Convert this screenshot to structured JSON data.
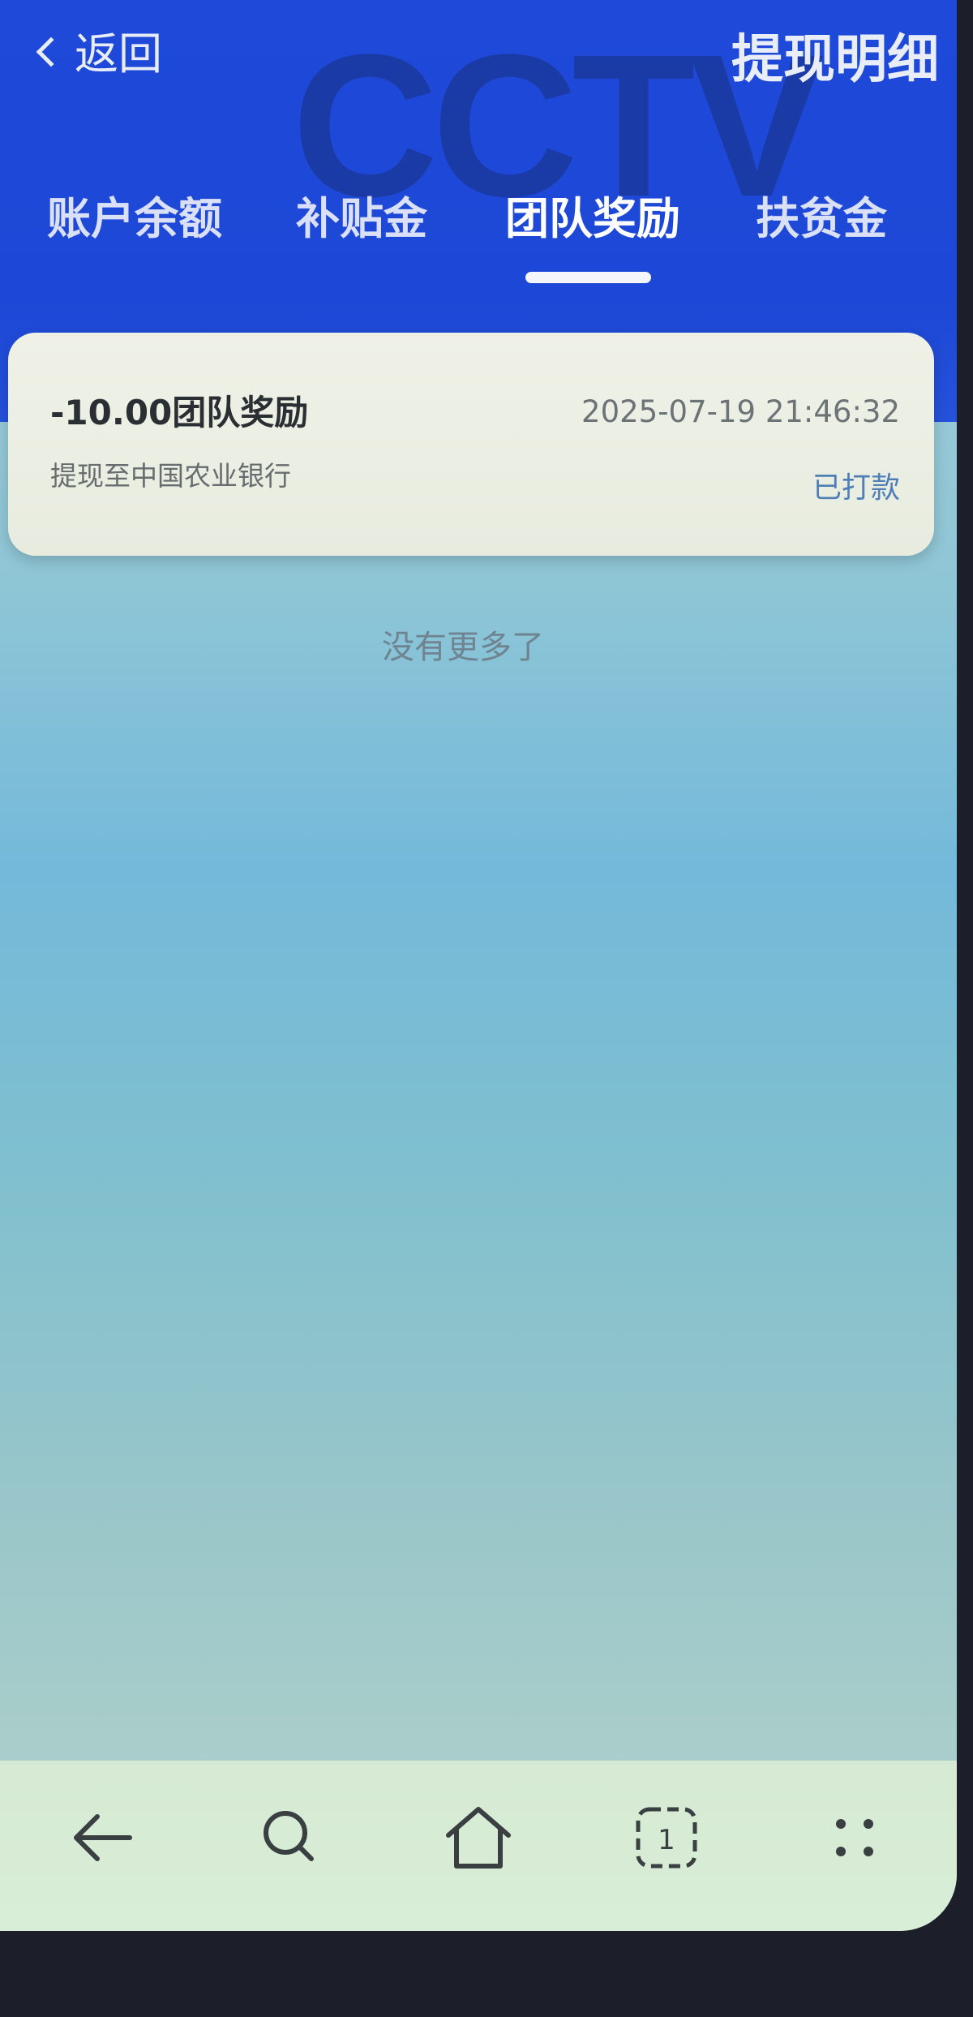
{
  "header": {
    "back_label": "返回",
    "title": "提现明细",
    "watermark": "CCTV",
    "accent_color": "#1f49d8"
  },
  "tabs": [
    {
      "label": "账户余额",
      "active": false
    },
    {
      "label": "补贴金",
      "active": false
    },
    {
      "label": "团队奖励",
      "active": true
    },
    {
      "label": "扶贫金",
      "active": false
    }
  ],
  "records": [
    {
      "amount_title": "-10.00团队奖励",
      "datetime": "2025-07-19 21:46:32",
      "description": "提现至中国农业银行",
      "status": "已打款"
    }
  ],
  "list_end_text": "没有更多了",
  "bottom_nav": {
    "items": [
      {
        "icon": "back-arrow-icon"
      },
      {
        "icon": "search-icon"
      },
      {
        "icon": "home-icon"
      },
      {
        "icon": "tabs-icon",
        "count": "1"
      },
      {
        "icon": "more-dots-icon"
      }
    ]
  }
}
